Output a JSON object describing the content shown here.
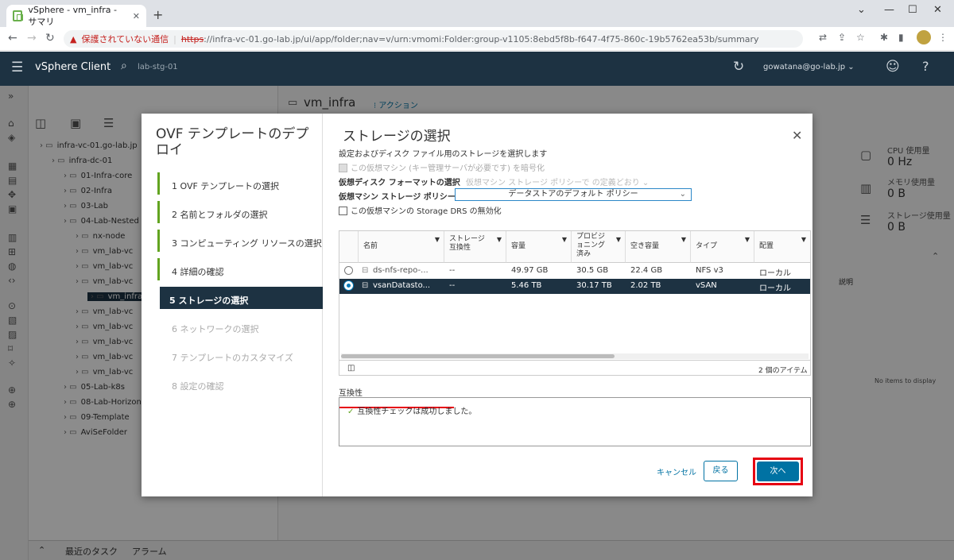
{
  "browser": {
    "tab_title": "vSphere - vm_infra - サマリ",
    "tab_close": "✕",
    "new_tab": "+",
    "security_warning": "保護されていない通信",
    "url_scheme": "https",
    "url_rest": "://infra-vc-01.go-lab.jp/ui/app/folder;nav=v/urn:vmomi:Folder:group-v1105:8ebd5f8b-f647-4f75-860c-19b5762ea53b/summary",
    "window_controls": [
      "⌄",
      "—",
      "☐",
      "✕"
    ]
  },
  "vsphere": {
    "brand": "vSphere Client",
    "search_text": "lab-stg-01",
    "user": "gowatana@go-lab.jp ⌄",
    "header_title": "vm_infra",
    "actions": "⁝ アクション",
    "summary": [
      {
        "label": "CPU 使用量",
        "value": "0 Hz"
      },
      {
        "label": "メモリ使用量",
        "value": "0 B"
      },
      {
        "label": "ストレージ使用量",
        "value": "0 B"
      }
    ],
    "right_table_header": "説明",
    "no_items": "No items to display",
    "bottom": {
      "recent_tasks": "最近のタスク",
      "alarms": "アラーム"
    }
  },
  "tree": [
    {
      "label": "infra-vc-01.go-lab.jp",
      "indent": 0
    },
    {
      "label": "infra-dc-01",
      "indent": 1
    },
    {
      "label": "01-Infra-core",
      "indent": 2
    },
    {
      "label": "02-Infra",
      "indent": 2
    },
    {
      "label": "03-Lab",
      "indent": 2
    },
    {
      "label": "04-Lab-Nested",
      "indent": 2
    },
    {
      "label": "nx-node",
      "indent": 3
    },
    {
      "label": "vm_lab-vc",
      "indent": 3
    },
    {
      "label": "vm_lab-vc",
      "indent": 3
    },
    {
      "label": "vm_lab-vc",
      "indent": 3
    },
    {
      "label": "vm_infra",
      "indent": 4
    },
    {
      "label": "vm_lab-vc",
      "indent": 3
    },
    {
      "label": "vm_lab-vc",
      "indent": 3
    },
    {
      "label": "vm_lab-vc",
      "indent": 3
    },
    {
      "label": "vm_lab-vc",
      "indent": 3
    },
    {
      "label": "vm_lab-vc",
      "indent": 3
    },
    {
      "label": "05-Lab-k8s",
      "indent": 2
    },
    {
      "label": "08-Lab-Horizon",
      "indent": 2
    },
    {
      "label": "09-Template",
      "indent": 2
    },
    {
      "label": "AviSeFolder",
      "indent": 2
    }
  ],
  "wizard": {
    "title": "OVF テンプレートのデプロイ",
    "steps": [
      {
        "label": "1  OVF テンプレートの選択",
        "state": "done"
      },
      {
        "label": "2  名前とフォルダの選択",
        "state": "done"
      },
      {
        "label": "3  コンピューティング リソースの選択",
        "state": "done"
      },
      {
        "label": "4  詳細の確認",
        "state": "done"
      },
      {
        "label": "5  ストレージの選択",
        "state": "current"
      },
      {
        "label": "6  ネットワークの選択",
        "state": "disabled"
      },
      {
        "label": "7  テンプレートのカスタマイズ",
        "state": "disabled"
      },
      {
        "label": "8  設定の確認",
        "state": "disabled"
      }
    ],
    "page_title": "ストレージの選択",
    "close": "✕",
    "description": "設定およびディスク ファイル用のストレージを選択します",
    "encrypt_label": "この仮想マシン (キー管理サーバが必要です) を暗号化",
    "disk_format_label": "仮想ディスク フォーマットの選択",
    "disk_format_value": "仮想マシン ストレージ ポリシーで の定義どおり ⌄",
    "policy_label": "仮想マシン ストレージ ポリシー",
    "policy_value": "データストアのデフォルト ポリシー",
    "drs_label": "この仮想マシンの Storage DRS の無効化",
    "columns": [
      "名前",
      "ストレージ 互換性",
      "容量",
      "プロビジョニング済み",
      "空き容量",
      "タイプ",
      "配置"
    ],
    "column_lines": [
      [
        "名前"
      ],
      [
        "ストレージ",
        "互換性"
      ],
      [
        "容量"
      ],
      [
        "プロビジ",
        "ョニング",
        "済み"
      ],
      [
        "空き容量"
      ],
      [
        "タイプ"
      ],
      [
        "配置"
      ]
    ],
    "rows": [
      {
        "name": "ds-nfs-repo-...",
        "compat": "--",
        "capacity": "49.97 GB",
        "provisioned": "30.5 GB",
        "free": "22.4 GB",
        "type": "NFS v3",
        "placement": "ローカル",
        "selected": false
      },
      {
        "name": "vsanDatasto...",
        "compat": "--",
        "capacity": "5.46 TB",
        "provisioned": "30.17 TB",
        "free": "2.02 TB",
        "type": "vSAN",
        "placement": "ローカル",
        "selected": true
      }
    ],
    "item_count": "2 個のアイテム",
    "compat_label": "互換性",
    "compat_message": "互換性チェックは成功しました。",
    "cancel": "キャンセル",
    "back": "戻る",
    "next": "次へ"
  },
  "colors": {
    "header": "#1d3242",
    "accent": "#0072a3",
    "success": "#62a420",
    "highlight": "#e60012"
  }
}
